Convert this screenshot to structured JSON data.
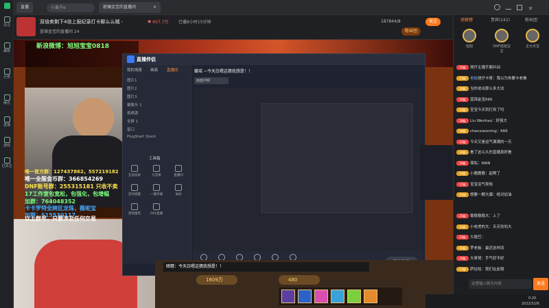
{
  "topbar": {
    "tab1": "直播",
    "search_placeholder": "小黄子e",
    "tab2": "斑斓金宝的直播间",
    "tab2_close": "×"
  },
  "leftnav": {
    "items": [
      "关注",
      "推荐",
      "分类",
      "娱乐",
      "直播",
      "游戏",
      "更多",
      "主播",
      "已关注",
      "任务"
    ]
  },
  "room": {
    "title": "双倍卖剩下4倍上报纪录打卡聊么么贼 -",
    "viewers": "657.7万",
    "subscribe": "已播8小时15分钟",
    "followers": "187844/8",
    "follow_btn": "关注",
    "fan_badge": "粉丝团",
    "sub_line": "蓝锦金宝的直播间 24"
  },
  "overlay": {
    "line1": "新浪微博：旭旭宝宝0818",
    "line2": "唯一全服金币群：366854269",
    "line3": "DNF账号群：255315181 只收不卖",
    "line4": "17工作室包宽松，包强化，包增幅",
    "line5": "加群：764048352",
    "line6": "卡卡罗特全跨区龙珠，薇呢宝",
    "line7": "加群：515530117",
    "line8": "以上群号，只要涉及任何交易",
    "line_qq": "唯一官方群：127437862，557219182"
  },
  "obs": {
    "title": "直播伴侣",
    "tabs": [
      "我的场景",
      "画面",
      "直播间"
    ],
    "scenes": [
      "图片1",
      "图片2",
      "图片3",
      "摄像头 1",
      "视频源",
      "全屏 1",
      "窗口",
      "PlugStart Stock"
    ],
    "tools_title": "工具箱",
    "tools": [
      "互动投屏",
      "九宫格",
      "直播间",
      "定时提醒",
      "一键开播",
      "录屏",
      "游戏推荐",
      "OBS直播"
    ],
    "stream_title": "蝶瑶 ~今天白嗯这猜我想是！！",
    "bottom_controls": [
      "直播屏幕",
      "摄像头",
      "手机投屏",
      "多媒体",
      "麦克风",
      "扬声器"
    ],
    "start_btn": "开始直播",
    "room_label": "画面冲频"
  },
  "game": {
    "dialog": "暗精：今天白嗯这猜我想是！！",
    "gold1": "1609万",
    "gold2": "480"
  },
  "right": {
    "tabs": [
      "贡献榜",
      "贵宾(242)",
      "粉丝团"
    ],
    "ranks": [
      "旭旭",
      "DNF旭旭宝宝",
      "正大天宝"
    ],
    "chat": [
      {
        "lvl": "25级",
        "name": "",
        "msg": "旭仔主播手腕抖动",
        "color": "#e44"
      },
      {
        "lvl": "21级",
        "name": "老板",
        "msg": "旭仔卡哥：我以为你要卡老佛",
        "color": "#e5a123"
      },
      {
        "lvl": "18级",
        "name": "",
        "msg": "当你说出那么多大法",
        "color": "#e5a123"
      },
      {
        "lvl": "24级",
        "name": "",
        "msg": "蓝锦金宝666",
        "color": "#e44"
      },
      {
        "lvl": "22级",
        "name": "",
        "msg": "宝宝今天剑打到了吗",
        "color": "#e5a123"
      },
      {
        "lvl": "28级",
        "name": "",
        "msg": "Liu Wenhao：好强大",
        "color": "#e44"
      },
      {
        "lvl": "26级",
        "name": "",
        "msg": "chenxiaoming：666",
        "color": "#e5a123"
      },
      {
        "lvl": "23级",
        "name": "",
        "msg": "今天又是运气满满的一天",
        "color": "#e44"
      },
      {
        "lvl": "24级",
        "name": "",
        "msg": "看了这么久的直播真好看",
        "color": "#e5a123"
      },
      {
        "lvl": "20级",
        "name": "",
        "msg": "保佑：WAN",
        "color": "#e44"
      },
      {
        "lvl": "19级",
        "name": "",
        "msg": "小鹿鹿鹿：起啊了",
        "color": "#e5a123"
      },
      {
        "lvl": "17级",
        "name": "",
        "msg": "宝宝运气来啦",
        "color": "#e44"
      },
      {
        "lvl": "22级",
        "name": "",
        "msg": "想要一颗大爆：绝对加油",
        "color": "#e5a123"
      },
      {
        "lvl": "",
        "name": "",
        "msg": "",
        "color": "#888"
      },
      {
        "lvl": "25级",
        "name": "",
        "msg": "稳稳稳稳大：上了",
        "color": "#e44"
      },
      {
        "lvl": "21级",
        "name": "",
        "msg": "小老虎的大：天天劝劝大",
        "color": "#e5a123"
      },
      {
        "lvl": "23级",
        "name": "",
        "msg": "大尾巴：",
        "color": "#e44"
      },
      {
        "lvl": "20级",
        "name": "",
        "msg": "罗老板：最近这时间",
        "color": "#e5a123"
      },
      {
        "lvl": "18级",
        "name": "",
        "msg": "大哥哥：手气好不好",
        "color": "#e44"
      },
      {
        "lvl": "27级",
        "name": "",
        "msg": "萨拉哈：我们在此哦",
        "color": "#e5a123"
      }
    ],
    "input_placeholder": "这里输入聊天内容",
    "send": "发送"
  },
  "taskbar": {
    "time": "0:20",
    "date": "2022/3/26"
  }
}
